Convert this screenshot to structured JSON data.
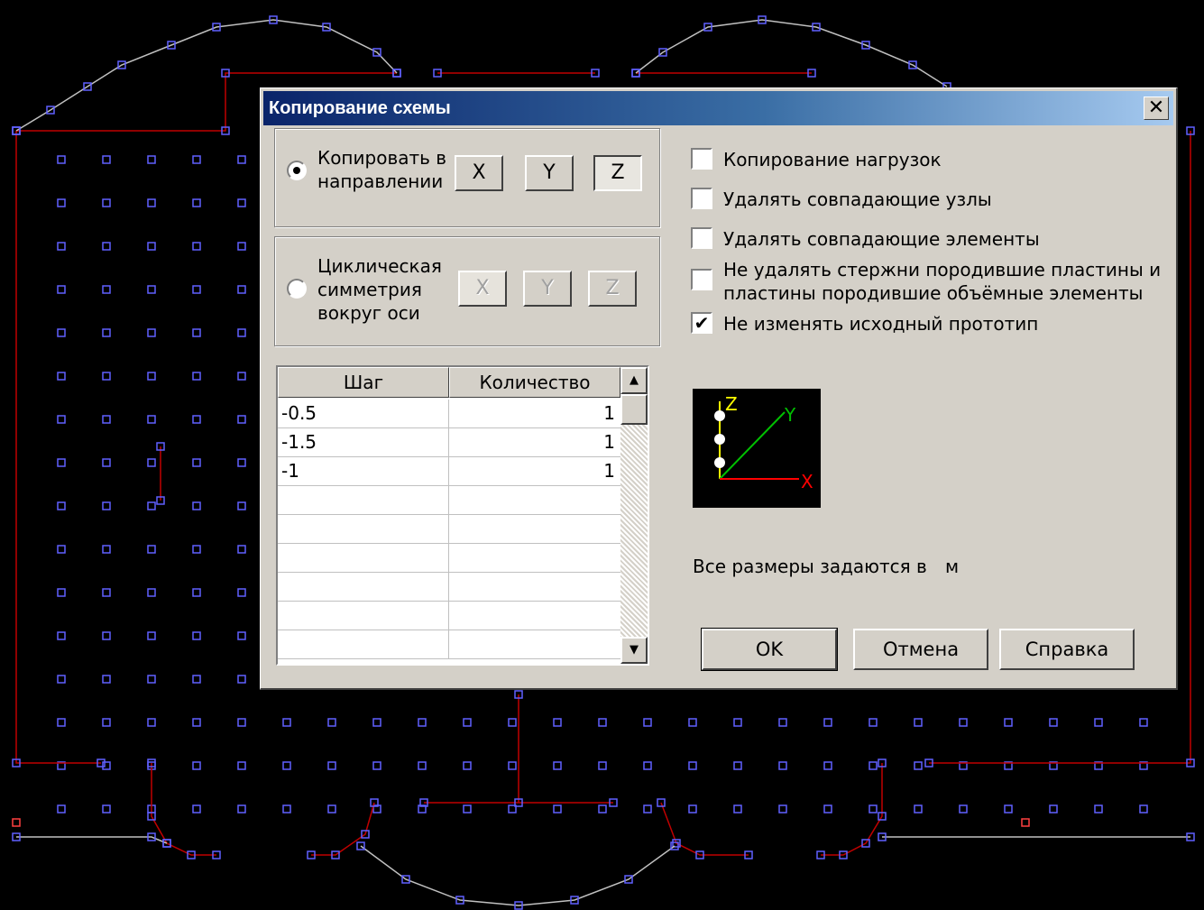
{
  "dialog": {
    "title": "Копирование схемы",
    "close_label": "✕"
  },
  "copy_direction": {
    "label_line1": "Копировать в",
    "label_line2": "направлении",
    "selected": true,
    "buttons": [
      "X",
      "Y",
      "Z"
    ],
    "active_axis": "Z"
  },
  "cyclic_symmetry": {
    "label_line1": "Циклическая",
    "label_line2": "симметрия",
    "label_line3": "вокруг оси",
    "selected": false,
    "buttons": [
      "X",
      "Y",
      "Z"
    ]
  },
  "options": [
    {
      "label": "Копирование нагрузок",
      "checked": false
    },
    {
      "label": "Удалять совпадающие узлы",
      "checked": false
    },
    {
      "label": "Удалять совпадающие элементы",
      "checked": false
    },
    {
      "label_line1": "Не удалять стержни породившие пластины и",
      "label_line2": "пластины породившие объёмные элементы",
      "checked": false
    },
    {
      "label": "Не изменять исходный прототип",
      "checked": true
    }
  ],
  "table": {
    "columns": [
      "Шаг",
      "Количество"
    ],
    "rows": [
      {
        "step": "-0.5",
        "count": "1"
      },
      {
        "step": "-1.5",
        "count": "1"
      },
      {
        "step": "-1",
        "count": "1"
      }
    ]
  },
  "axes_preview": {
    "labels": [
      "Z",
      "Y",
      "X"
    ],
    "colors": {
      "z": "#ffff00",
      "y": "#00c000",
      "x": "#ff0000"
    }
  },
  "units": {
    "text": "Все размеры задаются в",
    "unit": "м"
  },
  "buttons": {
    "ok": "OK",
    "cancel": "Отмена",
    "help": "Справка"
  },
  "colors": {
    "background": "#000000",
    "node": "#6060ff",
    "element": "#c00000",
    "outline": "#c0c0c0",
    "dialog": "#d4d0c8",
    "titlebar": "#0a246a"
  }
}
